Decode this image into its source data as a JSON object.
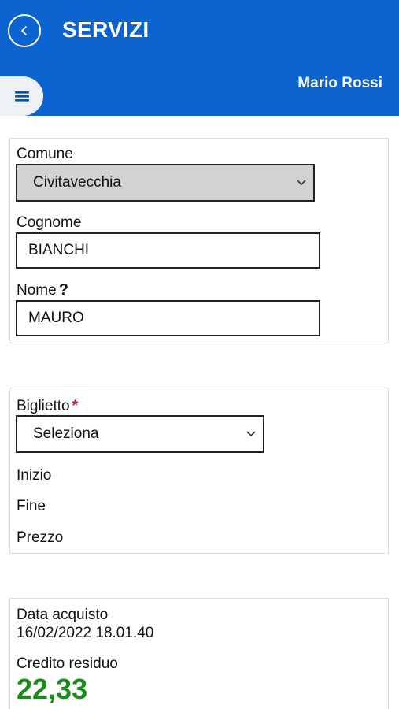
{
  "header": {
    "title": "SERVIZI",
    "user_name": "Mario Rossi",
    "bg_color": "#0a63cf"
  },
  "icons": {
    "back": "chevron-left-icon",
    "menu": "hamburger-menu-icon",
    "select": "chevron-down-icon",
    "help": "question-mark-icon"
  },
  "anagrafica": {
    "comune_label": "Comune",
    "comune_value": "Civitavecchia",
    "cognome_label": "Cognome",
    "cognome_value": "BIANCHI",
    "nome_label": "Nome",
    "nome_help": "?",
    "nome_value": "MAURO"
  },
  "biglietto": {
    "label": "Biglietto",
    "required_mark": "*",
    "select_value": "Seleziona",
    "inizio_label": "Inizio",
    "fine_label": "Fine",
    "prezzo_label": "Prezzo"
  },
  "acquisto": {
    "data_label": "Data acquisto",
    "data_value": "16/02/2022 18.01.40",
    "credito_label": "Credito residuo",
    "credito_value": "22,33",
    "credito_color": "#1a8a1a"
  }
}
